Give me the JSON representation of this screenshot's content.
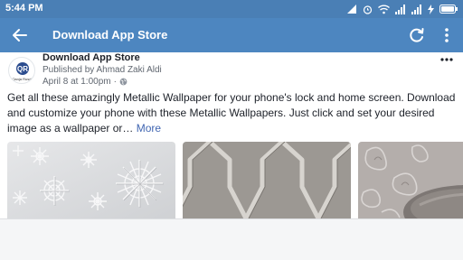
{
  "status_bar": {
    "time": "5:44 PM",
    "icons": [
      "signal-icon",
      "alarm-icon",
      "wifi-icon",
      "cell-signal-icon",
      "cell-signal-icon",
      "charging-icon",
      "battery-icon"
    ]
  },
  "app_bar": {
    "title": "Download App Store",
    "back_icon": "arrow-left-icon",
    "refresh_icon": "refresh-icon",
    "menu_icon": "more-vertical-icon",
    "color": "#4d86c0"
  },
  "post": {
    "page_name": "Download App Store",
    "publisher": "Published by Ahmad Zaki Aldi",
    "date": "April 8 at 1:00pm",
    "separator": "·",
    "privacy_icon": "globe-icon",
    "menu_icon": "more-horizontal-icon",
    "text": "Get all these amazingly Metallic Wallpaper for your phone's lock and home screen. Download and customize your phone with these Metallic Wallpapers. Just click and set your desired image as a wallpaper or… ",
    "more_label": "More",
    "avatar_text": "QR",
    "avatar_caption": "Qanja Rusda",
    "images": [
      {
        "name": "wallpaper-snowflakes"
      },
      {
        "name": "wallpaper-lattice"
      },
      {
        "name": "wallpaper-damask"
      }
    ]
  }
}
